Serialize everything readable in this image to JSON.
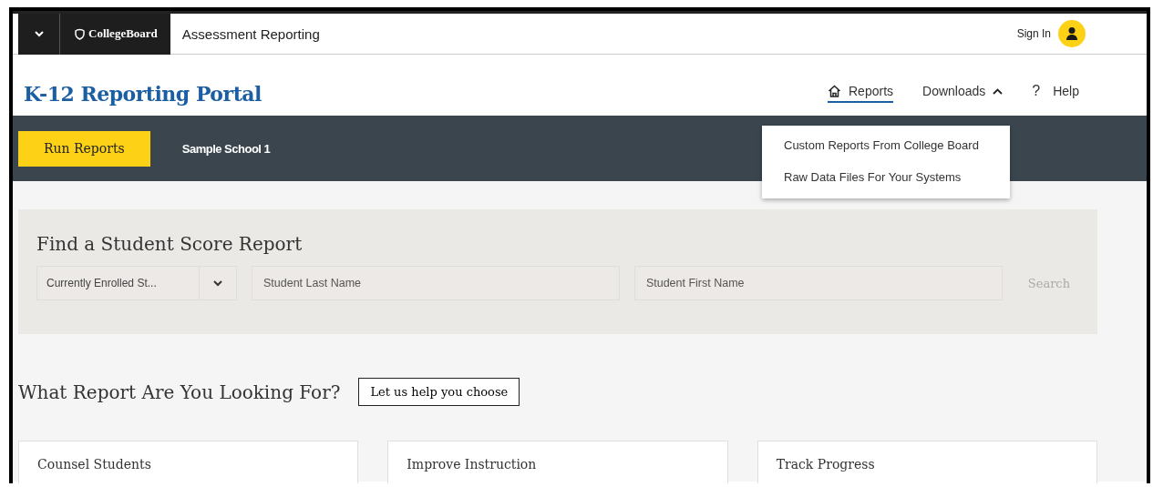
{
  "top_bar": {
    "brand": "CollegeBoard",
    "app_title": "Assessment Reporting",
    "sign_in": "Sign In"
  },
  "header": {
    "title": "K-12 Reporting Portal",
    "nav": [
      {
        "kind": "link",
        "label": "Reports",
        "selected": true
      },
      {
        "kind": "dropdown",
        "label": "Downloads",
        "expanded": true
      },
      {
        "kind": "help",
        "label": "Help",
        "icon": "?"
      }
    ]
  },
  "downloads_menu": [
    "Custom Reports From College Board",
    "Raw Data Files For Your Systems"
  ],
  "action_bar": {
    "button": "Run Reports",
    "school": "Sample School 1"
  },
  "search_panel": {
    "title": "Find a Student Score Report",
    "select": "Currently Enrolled St...",
    "last_name": {
      "placeholder": "Student Last Name"
    },
    "first_name": {
      "placeholder": "Student First Name"
    },
    "button": "Search"
  },
  "reports": {
    "title": "What Report Are You Looking For?",
    "help_button": "Let us help you choose",
    "cards": [
      "Counsel Students",
      "Improve Instruction",
      "Track Progress"
    ]
  }
}
